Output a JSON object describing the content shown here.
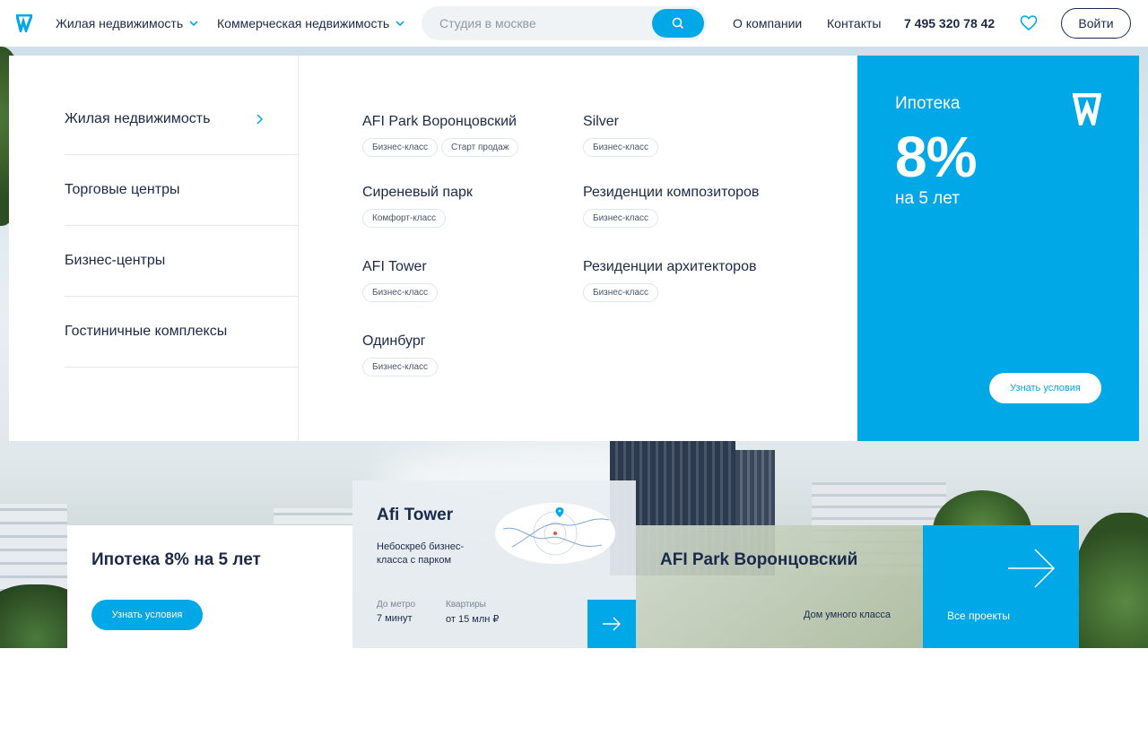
{
  "header": {
    "nav": [
      {
        "label": "Жилая недвижимость"
      },
      {
        "label": "Коммерческая недвижимость"
      }
    ],
    "search_placeholder": "Студия в москве",
    "about": "О компании",
    "contacts": "Контакты",
    "phone": "7 495 320 78 42",
    "login": "Войти"
  },
  "menu": {
    "categories": [
      {
        "label": "Жилая недвижимость"
      },
      {
        "label": "Торговые центры"
      },
      {
        "label": "Бизнес-центры"
      },
      {
        "label": "Гостиничные комплексы"
      }
    ],
    "projects": [
      {
        "name": "AFI Park Воронцовский",
        "tags": [
          "Бизнес-класс",
          "Старт продаж"
        ]
      },
      {
        "name": "Silver",
        "tags": [
          "Бизнес-класс"
        ]
      },
      {
        "name": "Сиреневый парк",
        "tags": [
          "Комфорт-класс"
        ]
      },
      {
        "name": "Резиденции композиторов",
        "tags": [
          "Бизнес-класс"
        ]
      },
      {
        "name": "AFI Tower",
        "tags": [
          "Бизнес-класс"
        ]
      },
      {
        "name": "Резиденции архитекторов",
        "tags": [
          "Бизнес-класс"
        ]
      },
      {
        "name": "Одинбург",
        "tags": [
          "Бизнес-класс"
        ]
      }
    ]
  },
  "promo": {
    "title": "Ипотека",
    "big": "8%",
    "sub": "на 5 лет",
    "button": "Узнать условия"
  },
  "cards": {
    "mortgage": {
      "title": "Ипотека 8% на 5 лет",
      "button": "Узнать условия"
    },
    "tower": {
      "title": "Afi Tower",
      "desc": "Небоскреб бизнес-класса с парком",
      "metro_label": "До метро",
      "metro_value": "7 минут",
      "flats_label": "Квартиры",
      "flats_value": "от 15 млн ₽"
    },
    "park": {
      "title": "AFI Park Воронцовский",
      "desc": "Дом умного класса"
    },
    "all": {
      "label": "Все проекты"
    }
  },
  "colors": {
    "accent": "#00a8e8",
    "text": "#1b2a4a"
  }
}
